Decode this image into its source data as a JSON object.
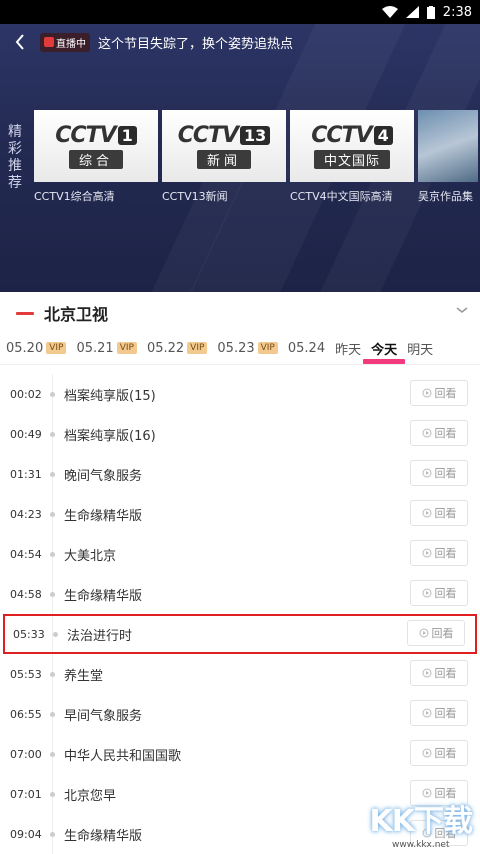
{
  "status_bar": {
    "time": "2:38"
  },
  "header": {
    "live_badge": "直播中",
    "message": "这个节目失踪了，换个姿势追热点"
  },
  "hero": {
    "side_label": "精彩推荐",
    "cards": [
      {
        "logo": "CCTV",
        "num": "1",
        "sub": "综合",
        "caption": "CCTV1综合高清"
      },
      {
        "logo": "CCTV",
        "num": "13",
        "sub": "新闻",
        "caption": "CCTV13新闻"
      },
      {
        "logo": "CCTV",
        "num": "4",
        "sub": "中文国际",
        "caption": "CCTV4中文国际高清"
      },
      {
        "caption": "吴京作品集"
      }
    ]
  },
  "channel": {
    "name": "北京卫视"
  },
  "dates": [
    {
      "label": "05.20",
      "vip": "VIP"
    },
    {
      "label": "05.21",
      "vip": "VIP"
    },
    {
      "label": "05.22",
      "vip": "VIP"
    },
    {
      "label": "05.23",
      "vip": "VIP"
    },
    {
      "label": "05.24"
    },
    {
      "label": "昨天"
    },
    {
      "label": "今天"
    },
    {
      "label": "明天"
    }
  ],
  "replay_label": "回看",
  "schedule": [
    {
      "time": "00:02",
      "title": "档案纯享版(15)"
    },
    {
      "time": "00:49",
      "title": "档案纯享版(16)"
    },
    {
      "time": "01:31",
      "title": "晚间气象服务"
    },
    {
      "time": "04:23",
      "title": "生命缘精华版"
    },
    {
      "time": "04:54",
      "title": "大美北京"
    },
    {
      "time": "04:58",
      "title": "生命缘精华版"
    },
    {
      "time": "05:33",
      "title": "法治进行时"
    },
    {
      "time": "05:53",
      "title": "养生堂"
    },
    {
      "time": "06:55",
      "title": "早间气象服务"
    },
    {
      "time": "07:00",
      "title": "中华人民共和国国歌"
    },
    {
      "time": "07:01",
      "title": "北京您早"
    },
    {
      "time": "09:04",
      "title": "生命缘精华版"
    }
  ],
  "watermark": {
    "big": "KK下载",
    "small": "www.kkx.net"
  }
}
